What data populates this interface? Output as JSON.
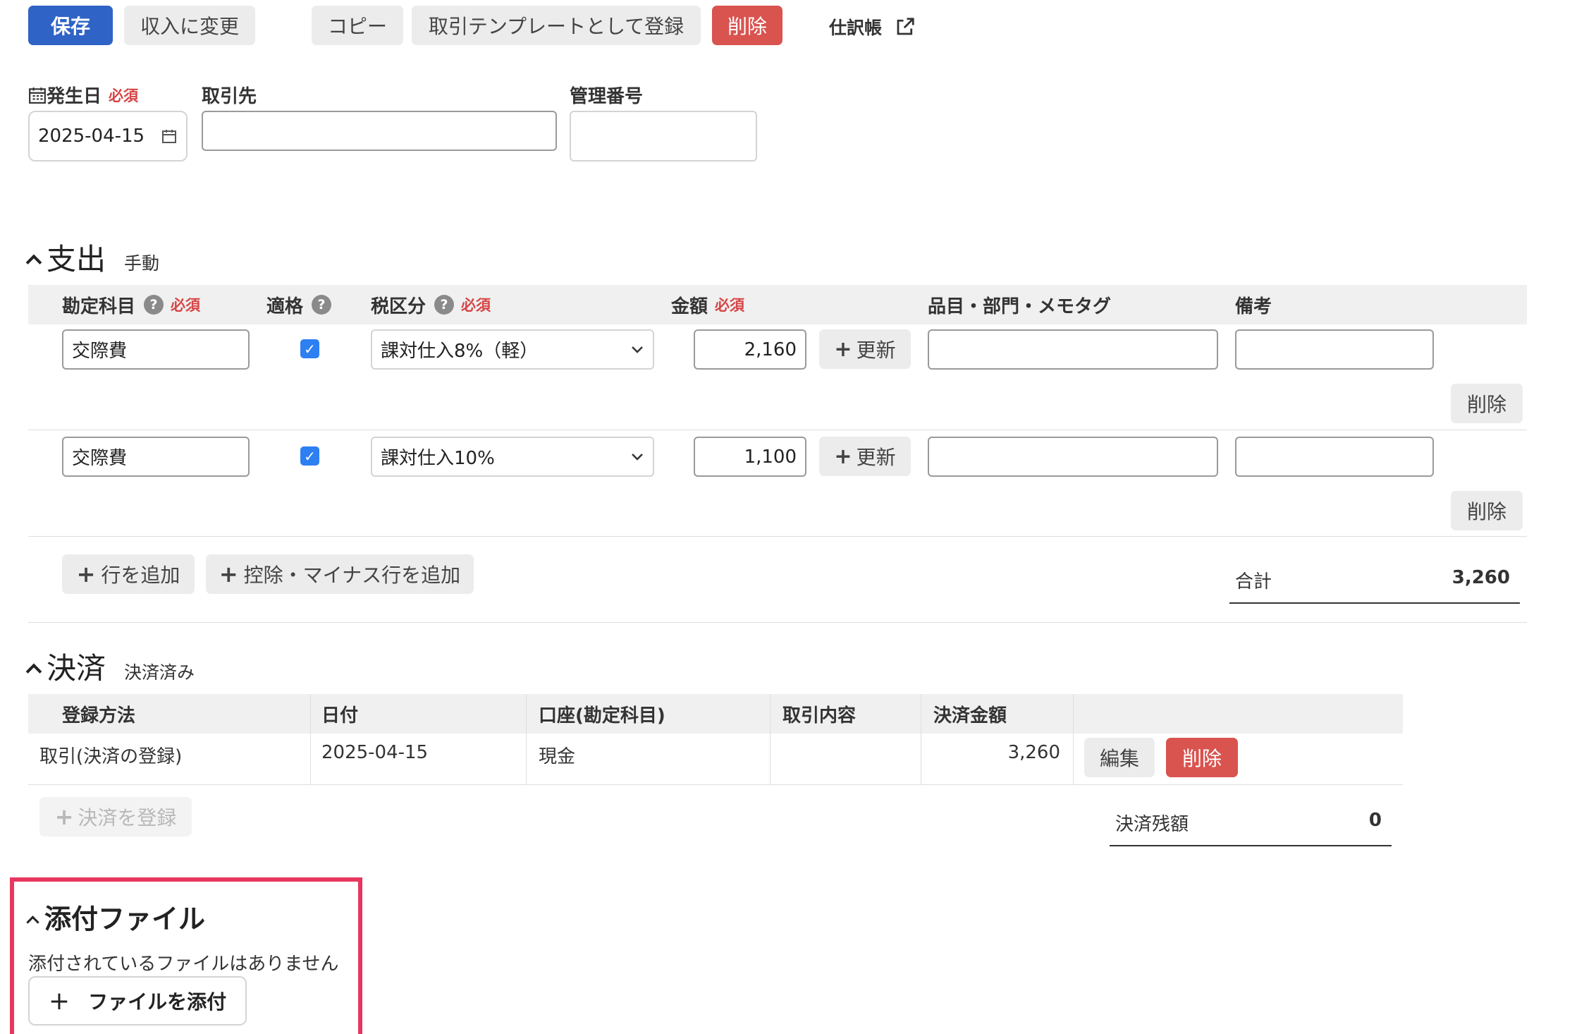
{
  "toolbar": {
    "save": "保存",
    "to_income": "収入に変更",
    "copy": "コピー",
    "register_template": "取引テンプレートとして登録",
    "delete": "削除",
    "journal": "仕訳帳"
  },
  "header_fields": {
    "date_label": "発生日",
    "required": "必須",
    "date_value": "2025-04-15",
    "partner_label": "取引先",
    "partner_value": "",
    "mgmt_label": "管理番号",
    "mgmt_value": ""
  },
  "expense": {
    "title": "支出",
    "mode": "手動",
    "columns": {
      "account": "勘定科目",
      "qualified": "適格",
      "tax": "税区分",
      "amount": "金額",
      "item_tags": "品目・部門・メモタグ",
      "remarks": "備考",
      "required": "必須"
    },
    "rows": [
      {
        "account": "交際費",
        "qualified": true,
        "tax": "課対仕入8%（軽）",
        "amount": "2,160",
        "update": "更新",
        "item_tags": "",
        "remarks": "",
        "delete": "削除"
      },
      {
        "account": "交際費",
        "qualified": true,
        "tax": "課対仕入10%",
        "amount": "1,100",
        "update": "更新",
        "item_tags": "",
        "remarks": "",
        "delete": "削除"
      }
    ],
    "add_row": "行を追加",
    "add_deduction_row": "控除・マイナス行を追加",
    "total_label": "合計",
    "total_value": "3,260"
  },
  "settlement": {
    "title": "決済",
    "status": "決済済み",
    "columns": [
      "登録方法",
      "日付",
      "口座(勘定科目)",
      "取引内容",
      "決済金額"
    ],
    "rows": [
      {
        "method": "取引(決済の登録)",
        "date": "2025-04-15",
        "account": "現金",
        "content": "",
        "amount": "3,260",
        "edit": "編集",
        "delete": "削除"
      }
    ],
    "register": "決済を登録",
    "balance_label": "決済残額",
    "balance_value": "0"
  },
  "attachments": {
    "title": "添付ファイル",
    "empty_text": "添付されているファイルはありません",
    "attach_button": "ファイルを添付"
  },
  "colors": {
    "primary": "#2f63c6",
    "danger": "#d9534f",
    "highlight": "#e8375f",
    "checkbox": "#2d7ff2"
  },
  "icons": [
    "calendar-icon",
    "external-link-icon",
    "help-icon",
    "plus-icon",
    "chevron-up-icon",
    "select-arrow-icon",
    "checkmark-icon"
  ]
}
